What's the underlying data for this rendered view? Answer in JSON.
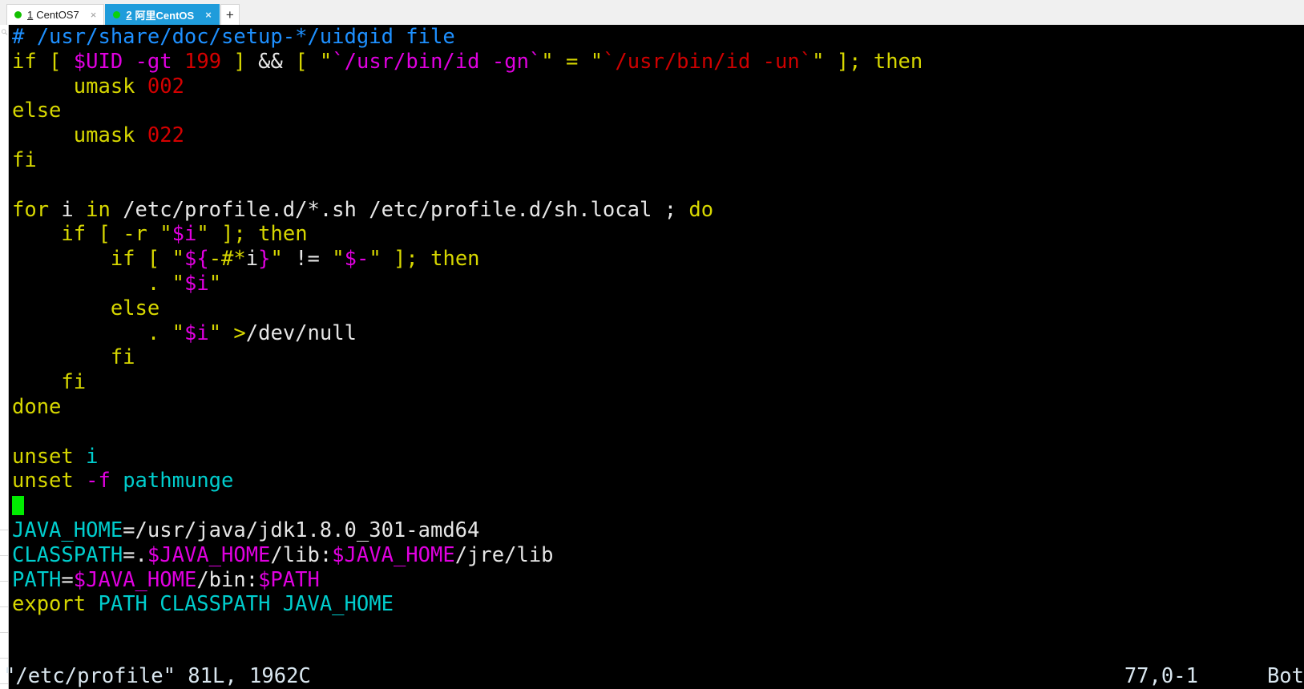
{
  "window": {
    "tabs": [
      {
        "num": "1",
        "label": "CentOS7",
        "dot": "connected-dot",
        "close": "×",
        "active": false
      },
      {
        "num": "2",
        "label": "阿里CentOS",
        "dot": "connected-dot",
        "close": "×",
        "active": true
      }
    ],
    "new_tab_label": "+"
  },
  "terminal": {
    "background": "#000000",
    "cursor_color": "#00ec00",
    "colors": {
      "comment": "#1e90ff",
      "statement": "#d7d700",
      "number": "#d40000",
      "string": "#cf0000",
      "identifier": "#00cdcd",
      "variable": "#e000e0",
      "normal": "#e6e6e6"
    },
    "lines": [
      {
        "id": "l1",
        "spans": [
          {
            "t": "# /usr/share/doc/setup-*/uidgid file",
            "c": "comment"
          }
        ]
      },
      {
        "id": "l2",
        "spans": [
          {
            "t": "if",
            "c": "statement"
          },
          {
            "t": " [ ",
            "c": "operator"
          },
          {
            "t": "$UID",
            "c": "variable"
          },
          {
            "t": " ",
            "c": "normal"
          },
          {
            "t": "-gt",
            "c": "variable"
          },
          {
            "t": " ",
            "c": "normal"
          },
          {
            "t": "199",
            "c": "number"
          },
          {
            "t": " ]",
            "c": "operator"
          },
          {
            "t": " && ",
            "c": "normal"
          },
          {
            "t": "[ ",
            "c": "operator"
          },
          {
            "t": "\"",
            "c": "operator"
          },
          {
            "t": "`/usr/bin/id ",
            "c": "variable"
          },
          {
            "t": "-gn",
            "c": "variable"
          },
          {
            "t": "`",
            "c": "variable"
          },
          {
            "t": "\"",
            "c": "operator"
          },
          {
            "t": " = ",
            "c": "operator"
          },
          {
            "t": "\"",
            "c": "operator"
          },
          {
            "t": "`/usr/bin/id -un`",
            "c": "string"
          },
          {
            "t": "\"",
            "c": "operator"
          },
          {
            "t": " ]; ",
            "c": "operator"
          },
          {
            "t": "then",
            "c": "statement"
          }
        ]
      },
      {
        "id": "l3",
        "spans": [
          {
            "t": "     umask ",
            "c": "statement"
          },
          {
            "t": "002",
            "c": "number"
          }
        ]
      },
      {
        "id": "l4",
        "spans": [
          {
            "t": "else",
            "c": "statement"
          }
        ]
      },
      {
        "id": "l5",
        "spans": [
          {
            "t": "     umask ",
            "c": "statement"
          },
          {
            "t": "022",
            "c": "number"
          }
        ]
      },
      {
        "id": "l6",
        "spans": [
          {
            "t": "fi",
            "c": "statement"
          }
        ]
      },
      {
        "id": "l7",
        "spans": [
          {
            "t": "",
            "c": "normal"
          }
        ]
      },
      {
        "id": "l8",
        "spans": [
          {
            "t": "for",
            "c": "statement"
          },
          {
            "t": " i ",
            "c": "normal"
          },
          {
            "t": "in",
            "c": "statement"
          },
          {
            "t": " /etc/profile.d/*.sh /etc/profile.d/sh.local ; ",
            "c": "normal"
          },
          {
            "t": "do",
            "c": "statement"
          }
        ]
      },
      {
        "id": "l9",
        "spans": [
          {
            "t": "    ",
            "c": "normal"
          },
          {
            "t": "if",
            "c": "statement"
          },
          {
            "t": " [ ",
            "c": "operator"
          },
          {
            "t": "-r",
            "c": "operator"
          },
          {
            "t": " ",
            "c": "normal"
          },
          {
            "t": "\"",
            "c": "operator"
          },
          {
            "t": "$i",
            "c": "variable"
          },
          {
            "t": "\"",
            "c": "operator"
          },
          {
            "t": " ]; ",
            "c": "operator"
          },
          {
            "t": "then",
            "c": "statement"
          }
        ]
      },
      {
        "id": "l10",
        "spans": [
          {
            "t": "        ",
            "c": "normal"
          },
          {
            "t": "if",
            "c": "statement"
          },
          {
            "t": " [ ",
            "c": "operator"
          },
          {
            "t": "\"",
            "c": "operator"
          },
          {
            "t": "${",
            "c": "variable"
          },
          {
            "t": "-#*",
            "c": "operator"
          },
          {
            "t": "i",
            "c": "normal"
          },
          {
            "t": "}",
            "c": "variable"
          },
          {
            "t": "\"",
            "c": "operator"
          },
          {
            "t": " != ",
            "c": "normal"
          },
          {
            "t": "\"",
            "c": "operator"
          },
          {
            "t": "$-",
            "c": "variable"
          },
          {
            "t": "\"",
            "c": "operator"
          },
          {
            "t": " ]; ",
            "c": "operator"
          },
          {
            "t": "then",
            "c": "statement"
          }
        ]
      },
      {
        "id": "l11",
        "spans": [
          {
            "t": "           ",
            "c": "normal"
          },
          {
            "t": ".",
            "c": "statement"
          },
          {
            "t": " ",
            "c": "normal"
          },
          {
            "t": "\"",
            "c": "operator"
          },
          {
            "t": "$i",
            "c": "variable"
          },
          {
            "t": "\"",
            "c": "operator"
          }
        ]
      },
      {
        "id": "l12",
        "spans": [
          {
            "t": "        ",
            "c": "normal"
          },
          {
            "t": "else",
            "c": "statement"
          }
        ]
      },
      {
        "id": "l13",
        "spans": [
          {
            "t": "           ",
            "c": "normal"
          },
          {
            "t": ".",
            "c": "statement"
          },
          {
            "t": " ",
            "c": "normal"
          },
          {
            "t": "\"",
            "c": "operator"
          },
          {
            "t": "$i",
            "c": "variable"
          },
          {
            "t": "\"",
            "c": "operator"
          },
          {
            "t": " ",
            "c": "normal"
          },
          {
            "t": ">",
            "c": "statement"
          },
          {
            "t": "/dev/null",
            "c": "normal"
          }
        ]
      },
      {
        "id": "l14",
        "spans": [
          {
            "t": "        ",
            "c": "normal"
          },
          {
            "t": "fi",
            "c": "statement"
          }
        ]
      },
      {
        "id": "l15",
        "spans": [
          {
            "t": "    ",
            "c": "normal"
          },
          {
            "t": "fi",
            "c": "statement"
          }
        ]
      },
      {
        "id": "l16",
        "spans": [
          {
            "t": "done",
            "c": "statement"
          }
        ]
      },
      {
        "id": "l17",
        "spans": [
          {
            "t": "",
            "c": "normal"
          }
        ]
      },
      {
        "id": "l18",
        "spans": [
          {
            "t": "unset",
            "c": "statement"
          },
          {
            "t": " ",
            "c": "normal"
          },
          {
            "t": "i",
            "c": "identifier"
          }
        ]
      },
      {
        "id": "l19",
        "spans": [
          {
            "t": "unset",
            "c": "statement"
          },
          {
            "t": " ",
            "c": "normal"
          },
          {
            "t": "-f",
            "c": "variable"
          },
          {
            "t": " ",
            "c": "normal"
          },
          {
            "t": "pathmunge",
            "c": "identifier"
          }
        ]
      },
      {
        "id": "l20",
        "cursor": true,
        "spans": [
          {
            "t": "",
            "c": "normal"
          }
        ]
      },
      {
        "id": "l21",
        "spans": [
          {
            "t": "JAVA_HOME",
            "c": "identifier"
          },
          {
            "t": "=/usr/java/jdk1.8.0_301-amd64",
            "c": "normal"
          }
        ]
      },
      {
        "id": "l22",
        "spans": [
          {
            "t": "CLASSPATH",
            "c": "identifier"
          },
          {
            "t": "=.",
            "c": "normal"
          },
          {
            "t": "$JAVA_HOME",
            "c": "variable"
          },
          {
            "t": "/lib:",
            "c": "normal"
          },
          {
            "t": "$JAVA_HOME",
            "c": "variable"
          },
          {
            "t": "/jre/lib",
            "c": "normal"
          }
        ]
      },
      {
        "id": "l23",
        "spans": [
          {
            "t": "PATH",
            "c": "identifier"
          },
          {
            "t": "=",
            "c": "normal"
          },
          {
            "t": "$JAVA_HOME",
            "c": "variable"
          },
          {
            "t": "/bin:",
            "c": "normal"
          },
          {
            "t": "$PATH",
            "c": "variable"
          }
        ]
      },
      {
        "id": "l24",
        "spans": [
          {
            "t": "export",
            "c": "statement"
          },
          {
            "t": " ",
            "c": "normal"
          },
          {
            "t": "PATH CLASSPATH JAVA_HOME",
            "c": "identifier"
          }
        ]
      }
    ],
    "status": {
      "file": "\"/etc/profile\" 81L, 1962C",
      "position": "77,0-1",
      "relative": "Bot"
    }
  }
}
